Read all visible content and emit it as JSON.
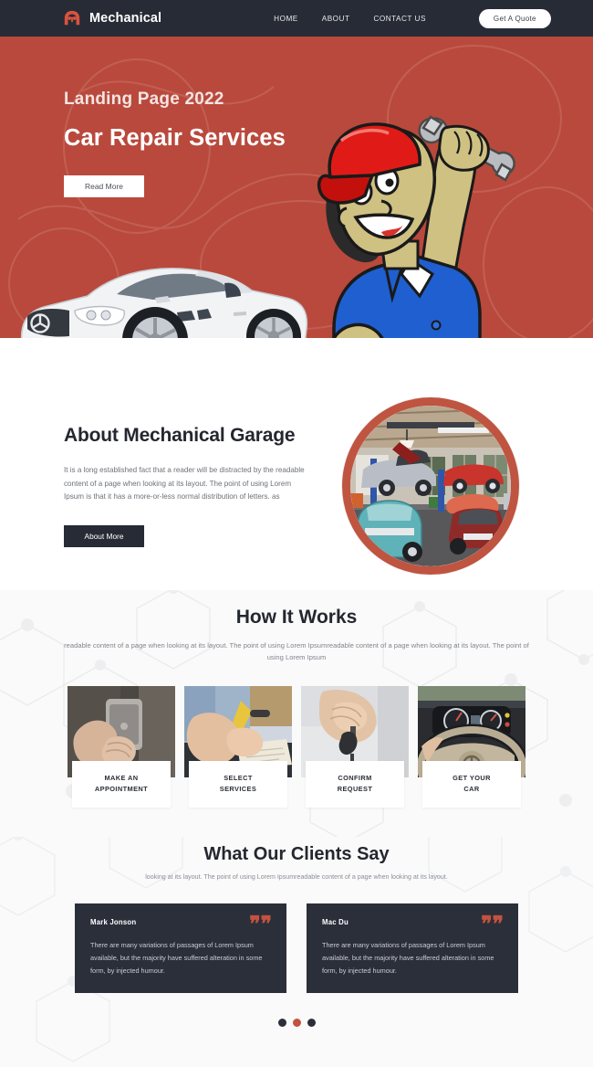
{
  "navbar": {
    "brand": "Mechanical",
    "logo_icon": "car-logo-icon",
    "links": [
      {
        "label": "HOME"
      },
      {
        "label": "ABOUT"
      },
      {
        "label": "CONTACT US"
      }
    ],
    "cta_label": "Get A Quote"
  },
  "hero": {
    "kicker": "Landing Page 2022",
    "title": "Car Repair Services",
    "button_label": "Read More",
    "background_color": "#b9493c",
    "illustration_car": "white-convertible-car-image",
    "illustration_mechanic": "cartoon-mechanic-with-wrench-image"
  },
  "about": {
    "title": "About Mechanical Garage",
    "body": "It is a long established fact that a reader will be distracted by the readable content of a page when looking at its layout. The point of using Lorem Ipsum is that it has a more-or-less normal distribution of letters. as",
    "button_label": "About More",
    "image": "garage-interior-photo",
    "frame_color": "#bf5441"
  },
  "how_it_works": {
    "title": "How It Works",
    "subtitle": "readable content of a page when looking at its layout. The point of using Lorem Ipsumreadable content of a page when looking at its layout. The point of using Lorem Ipsum",
    "steps": [
      {
        "label": "MAKE AN\nAPPOINTMENT",
        "image": "hand-holding-phone-photo"
      },
      {
        "label": "SELECT\nSERVICES",
        "image": "hand-writing-with-pen-photo"
      },
      {
        "label": "CONFIRM\nREQUEST",
        "image": "hand-holding-car-keys-photo"
      },
      {
        "label": "GET YOUR\nCAR",
        "image": "car-steering-wheel-photo"
      }
    ]
  },
  "testimonials": {
    "title": "What Our Clients Say",
    "subtitle": "looking at its layout. The point of using Lorem Ipsumreadable content of a page when looking at its layout.",
    "quote_mark": "“",
    "cards": [
      {
        "name": "Mark Jonson",
        "text": "There are many variations of passages of Lorem Ipsum available, but the majority have suffered alteration in some form, by injected humour."
      },
      {
        "name": "Mac Du",
        "text": "There are many variations of passages of Lorem Ipsum available, but the majority have suffered alteration in some form, by injected humour."
      }
    ],
    "dots": [
      {
        "active": false
      },
      {
        "active": true
      },
      {
        "active": false
      }
    ],
    "accent_color": "#c4523f",
    "card_background": "#2b2f3a"
  }
}
